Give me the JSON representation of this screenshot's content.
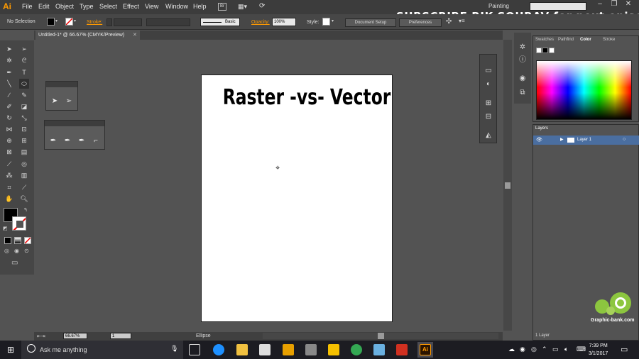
{
  "app": {
    "logo": "Ai",
    "menu": [
      "File",
      "Edit",
      "Object",
      "Type",
      "Select",
      "Effect",
      "View",
      "Window",
      "Help"
    ],
    "bridge_label": "Br",
    "workspace": "Painting",
    "watermark": "SUBSCRIBE RIK SOURAV for next episodes"
  },
  "controlbar": {
    "selection": "No Selection",
    "stroke_label": "Stroke:",
    "brush_label": "Basic",
    "opacity_label": "Opacity:",
    "opacity_value": "100%",
    "style_label": "Style:",
    "document_setup": "Document Setup",
    "preferences": "Preferences"
  },
  "document": {
    "tab_label": "Untitled-1* @ 66.67% (CMYK/Preview)",
    "artboard_title": "Raster -vs- Vector"
  },
  "panels": {
    "color_tabs": [
      "Swatches",
      "Pathfind",
      "Color",
      "Stroke"
    ],
    "layers_tab": "Layers",
    "layer_name": "Layer 1",
    "layers_count": "1 Layer"
  },
  "status": {
    "zoom": "66.67%",
    "artboard_num": "1",
    "tool_name": "Ellipse"
  },
  "taskbar": {
    "search_placeholder": "Ask me anything",
    "time": "7:39 PM",
    "date": "3/1/2017",
    "watermark_site": "Graphic-bank.com"
  },
  "colors": {
    "ai_orange": "#ff9a00",
    "ui_dark": "#3c3c3c",
    "ui_bg": "#535353",
    "layer_blue": "#4a6ea0"
  }
}
